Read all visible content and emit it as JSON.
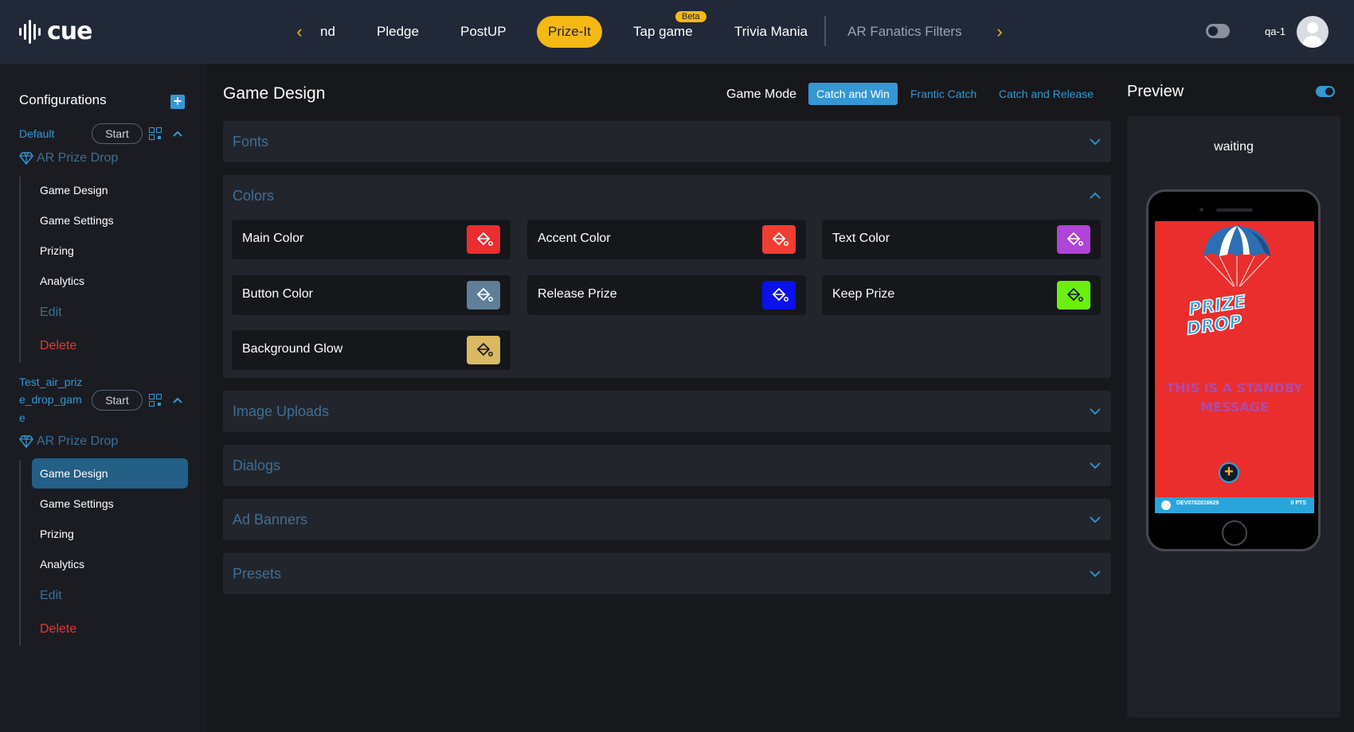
{
  "app": {
    "logo_text": "cue"
  },
  "nav": {
    "tabs": [
      {
        "label": "nd"
      },
      {
        "label": "Pledge"
      },
      {
        "label": "PostUP"
      },
      {
        "label": "Prize-It",
        "active": true
      },
      {
        "label": "Tap game",
        "badge": "Beta"
      },
      {
        "label": "Trivia Mania"
      },
      {
        "label": "AR Fanatics Filters"
      }
    ],
    "user": "qa-1"
  },
  "sidebar": {
    "title": "Configurations",
    "start_label": "Start",
    "configs": [
      {
        "name": "Default",
        "game": "AR Prize Drop",
        "items": [
          "Game Design",
          "Game Settings",
          "Prizing",
          "Analytics"
        ],
        "edit": "Edit",
        "delete": "Delete"
      },
      {
        "name_lines": [
          "Test_air_priz",
          "e_drop_gam",
          "e"
        ],
        "game": "AR Prize Drop",
        "items": [
          "Game Design",
          "Game Settings",
          "Prizing",
          "Analytics"
        ],
        "active_item": "Game Design",
        "edit": "Edit",
        "delete": "Delete"
      }
    ]
  },
  "main": {
    "title": "Game Design",
    "game_mode": {
      "label": "Game Mode",
      "options": [
        "Catch and Win",
        "Frantic Catch",
        "Catch and Release"
      ],
      "selected": "Catch and Win"
    },
    "sections": {
      "fonts": "Fonts",
      "colors": "Colors",
      "image_uploads": "Image Uploads",
      "dialogs": "Dialogs",
      "ad_banners": "Ad Banners",
      "presets": "Presets"
    },
    "colors": [
      {
        "name": "Main Color",
        "value": "#ea2e2e"
      },
      {
        "name": "Accent Color",
        "value": "#f23d32"
      },
      {
        "name": "Text Color",
        "value": "#b043d8"
      },
      {
        "name": "Button Color",
        "value": "#5f7f99"
      },
      {
        "name": "Release Prize",
        "value": "#0a10ee"
      },
      {
        "name": "Keep Prize",
        "value": "#6cf00f"
      },
      {
        "name": "Background Glow",
        "value": "#d9b962"
      }
    ]
  },
  "preview": {
    "title": "Preview",
    "status": "waiting",
    "logo_line1": "PRIZE",
    "logo_line2": "DROP",
    "standby_message": "THIS IS A STANDBY MESSAGE",
    "user_id": "DEV0782016629",
    "points": "0 PTS"
  },
  "colors": {
    "accent": "#f5b915",
    "link": "#3597d3",
    "danger": "#e53935"
  }
}
